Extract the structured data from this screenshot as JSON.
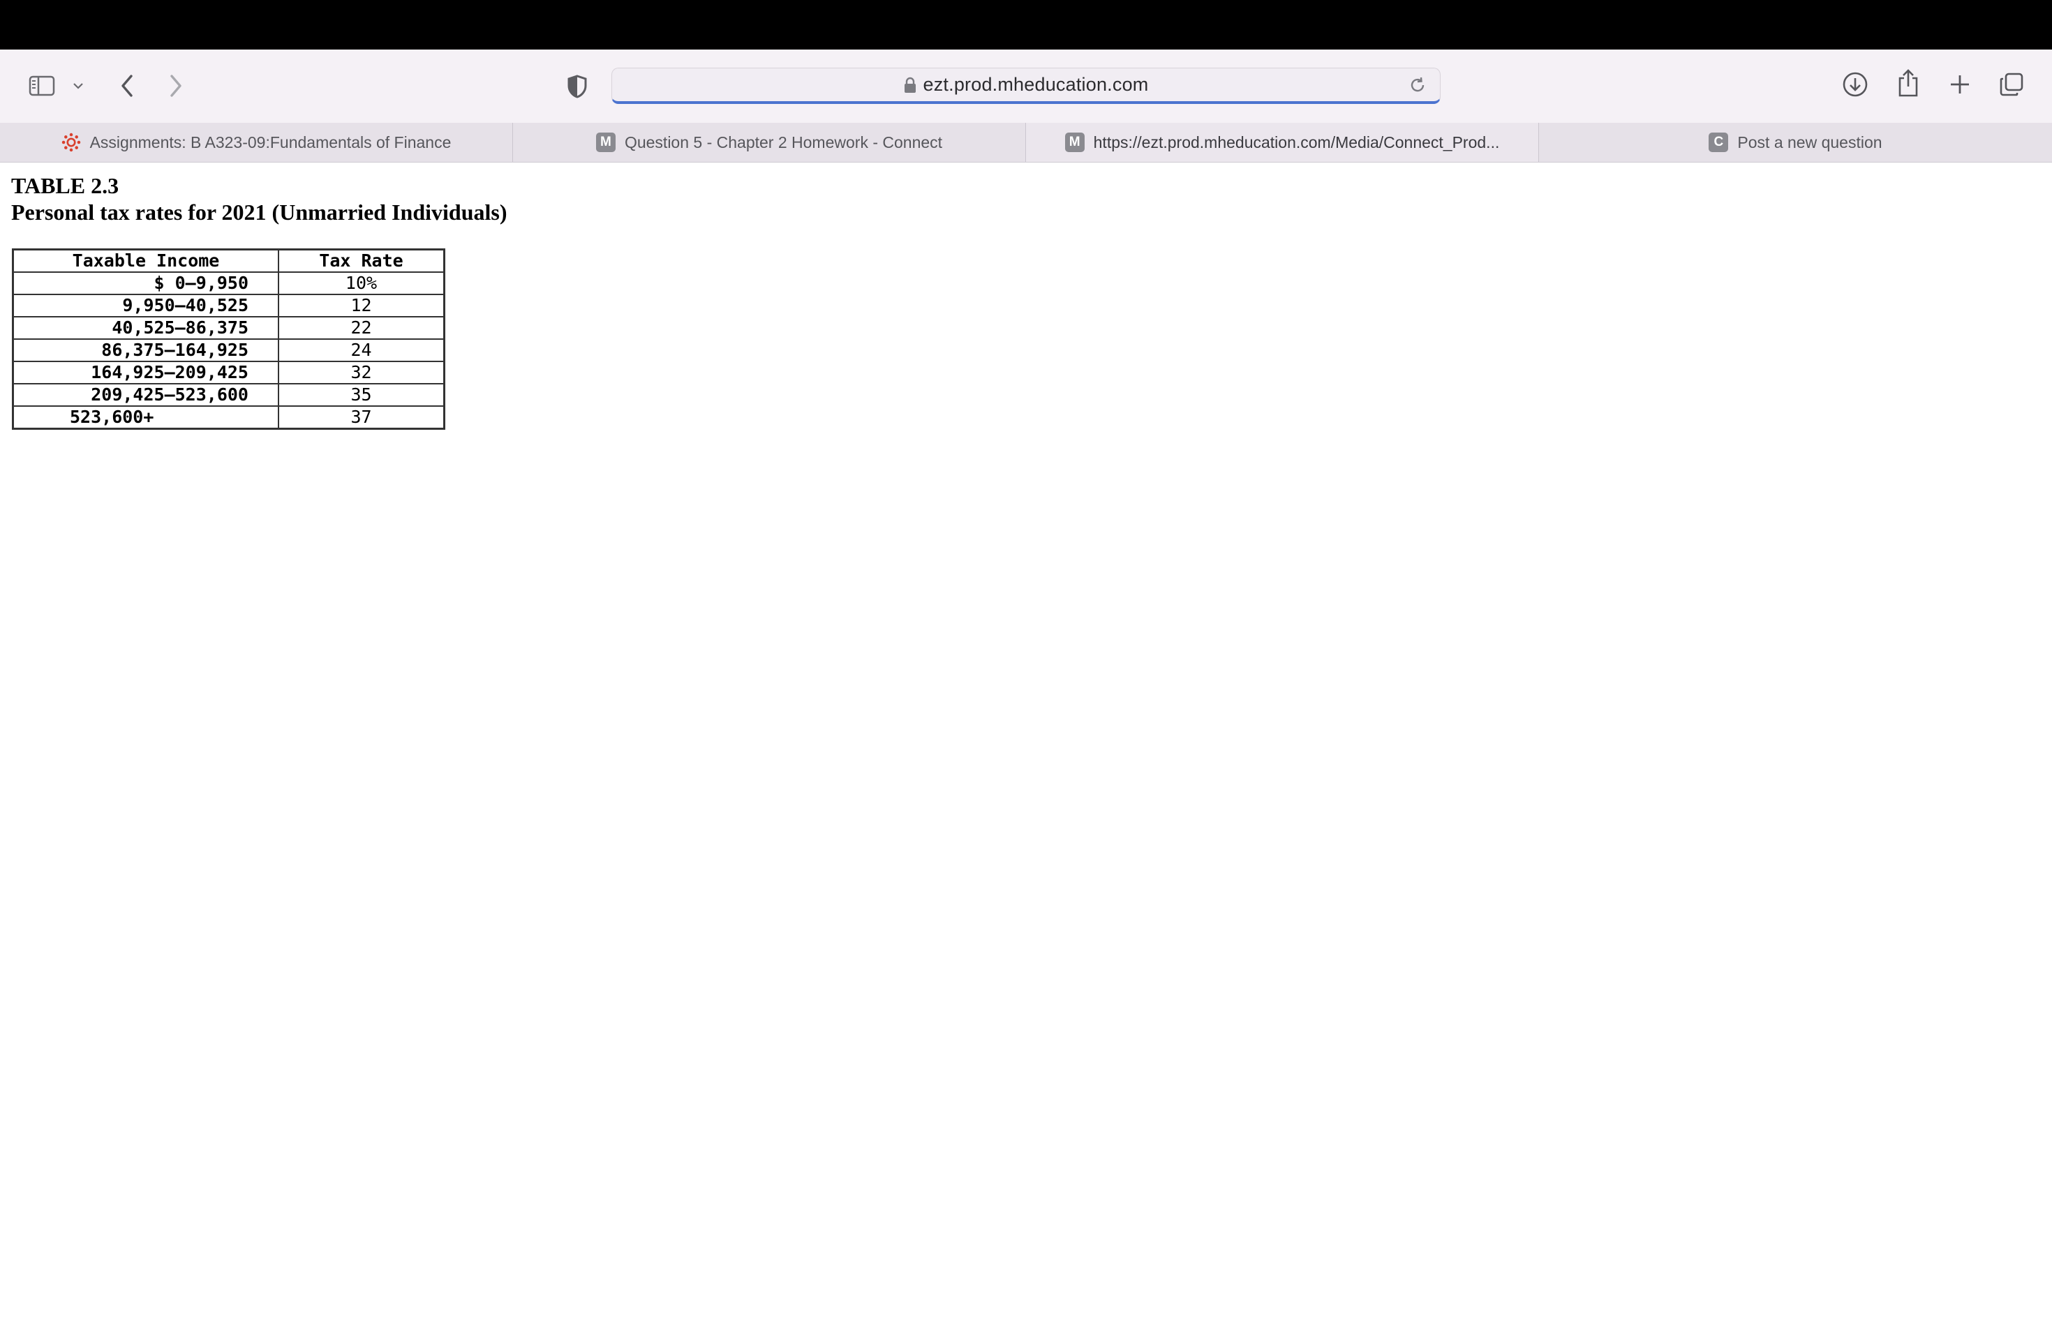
{
  "browser": {
    "address_bar": {
      "url": "ezt.prod.mheducation.com"
    },
    "tabs": [
      {
        "label": "Assignments: B A323-09:Fundamentals of Finance",
        "favicon": "canvas-icon",
        "favicon_letter": ""
      },
      {
        "label": "Question 5 - Chapter 2 Homework - Connect",
        "favicon": "mheducation-icon",
        "favicon_letter": "M"
      },
      {
        "label": "https://ezt.prod.mheducation.com/Media/Connect_Prod...",
        "favicon": "mheducation-icon",
        "favicon_letter": "M"
      },
      {
        "label": "Post a new question",
        "favicon": "chegg-icon",
        "favicon_letter": "C"
      }
    ],
    "active_tab_index": 2,
    "colors": {
      "toolbar_bg": "#f5f1f6",
      "address_underline": "#4b73cf",
      "canvas_red": "#d9402d"
    }
  },
  "page": {
    "table_number": "TABLE 2.3",
    "table_title": "Personal tax rates for 2021 (Unmarried Individuals)",
    "table": {
      "headers": [
        "Taxable Income",
        "Tax Rate"
      ],
      "rows": [
        {
          "income": "$ 0–9,950",
          "rate": "10%"
        },
        {
          "income": "9,950–40,525",
          "rate": "12"
        },
        {
          "income": "40,525–86,375",
          "rate": "22"
        },
        {
          "income": "86,375–164,925",
          "rate": "24"
        },
        {
          "income": "164,925–209,425",
          "rate": "32"
        },
        {
          "income": "209,425–523,600",
          "rate": "35"
        },
        {
          "income": "523,600+",
          "rate": "37"
        }
      ]
    }
  }
}
